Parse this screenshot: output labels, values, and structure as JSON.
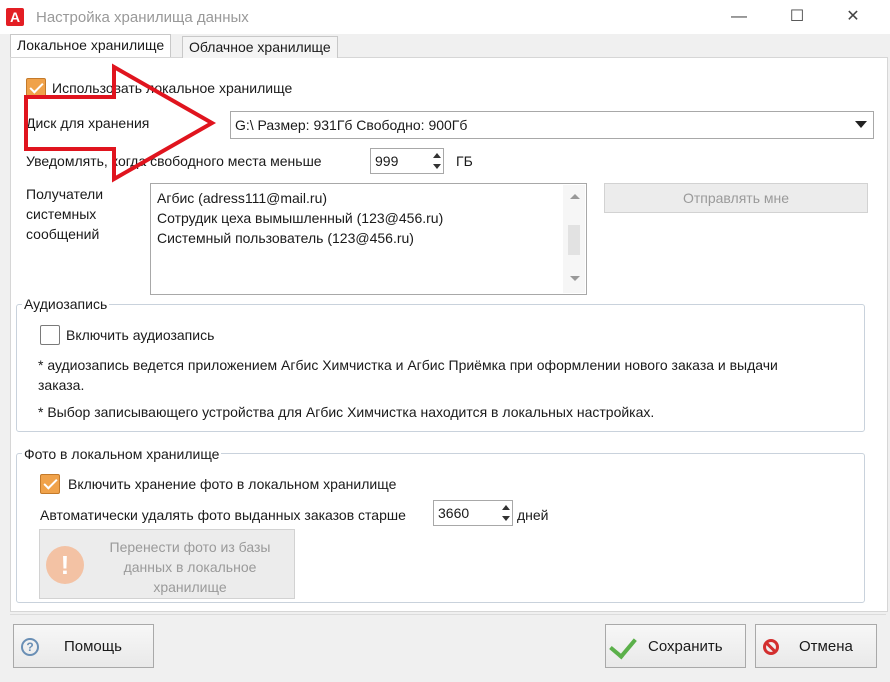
{
  "window": {
    "title": "Настройка хранилища данных",
    "minimize": "—",
    "maximize": "☐",
    "close": "✕"
  },
  "tabs": [
    {
      "label": "Локальное хранилище",
      "active": true
    },
    {
      "label": "Облачное хранилище",
      "active": false
    }
  ],
  "local": {
    "use_local_label": "Использовать локальное хранилище",
    "use_local_checked": true,
    "disk_label": "Диск для хранения",
    "disk_value": "G:\\ Размер: 931Гб Свободно: 900Гб",
    "notify_label": "Уведомлять, когда свободного места меньше",
    "notify_value": "999",
    "notify_unit": "ГБ",
    "recipients_label_1": "Получатели",
    "recipients_label_2": "системных",
    "recipients_label_3": "сообщений",
    "recipients": [
      "Агбис (adress111@mail.ru)",
      "Сотрудик цеха вымышленный (123@456.ru)",
      "Системный пользователь (123@456.ru)"
    ],
    "send_me_button": "Отправлять мне"
  },
  "audio": {
    "group_title": "Аудиозапись",
    "enable_label": "Включить аудиозапись",
    "enable_checked": false,
    "note_1a": "* аудиозапись ведется приложением Агбис Химчистка и Агбис Приёмка при оформлении нового заказа и выдачи",
    "note_1b": "заказа.",
    "note_2": "* Выбор записывающего устройства для Агбис Химчистка находится в локальных настройках."
  },
  "photo": {
    "group_title": "Фото в локальном хранилище",
    "enable_label": "Включить хранение фото в локальном хранилище",
    "enable_checked": true,
    "auto_delete_label": "Автоматически удалять фото выданных заказов старше",
    "auto_delete_value": "3660",
    "auto_delete_unit": "дней",
    "move_button_1": "Перенести фото из базы",
    "move_button_2": "данных в локальное",
    "move_button_3": "хранилище"
  },
  "footer": {
    "help": "Помощь",
    "save": "Сохранить",
    "cancel": "Отмена"
  },
  "colors": {
    "accent_checkbox": "#f0a24a",
    "annotation_arrow": "#e0141e",
    "app_logo": "#e31e24"
  },
  "icons": {
    "help": "help-icon",
    "save": "checkmark-icon",
    "cancel": "no-entry-icon",
    "move": "warning-icon",
    "annotation": "arrow-annotation"
  }
}
